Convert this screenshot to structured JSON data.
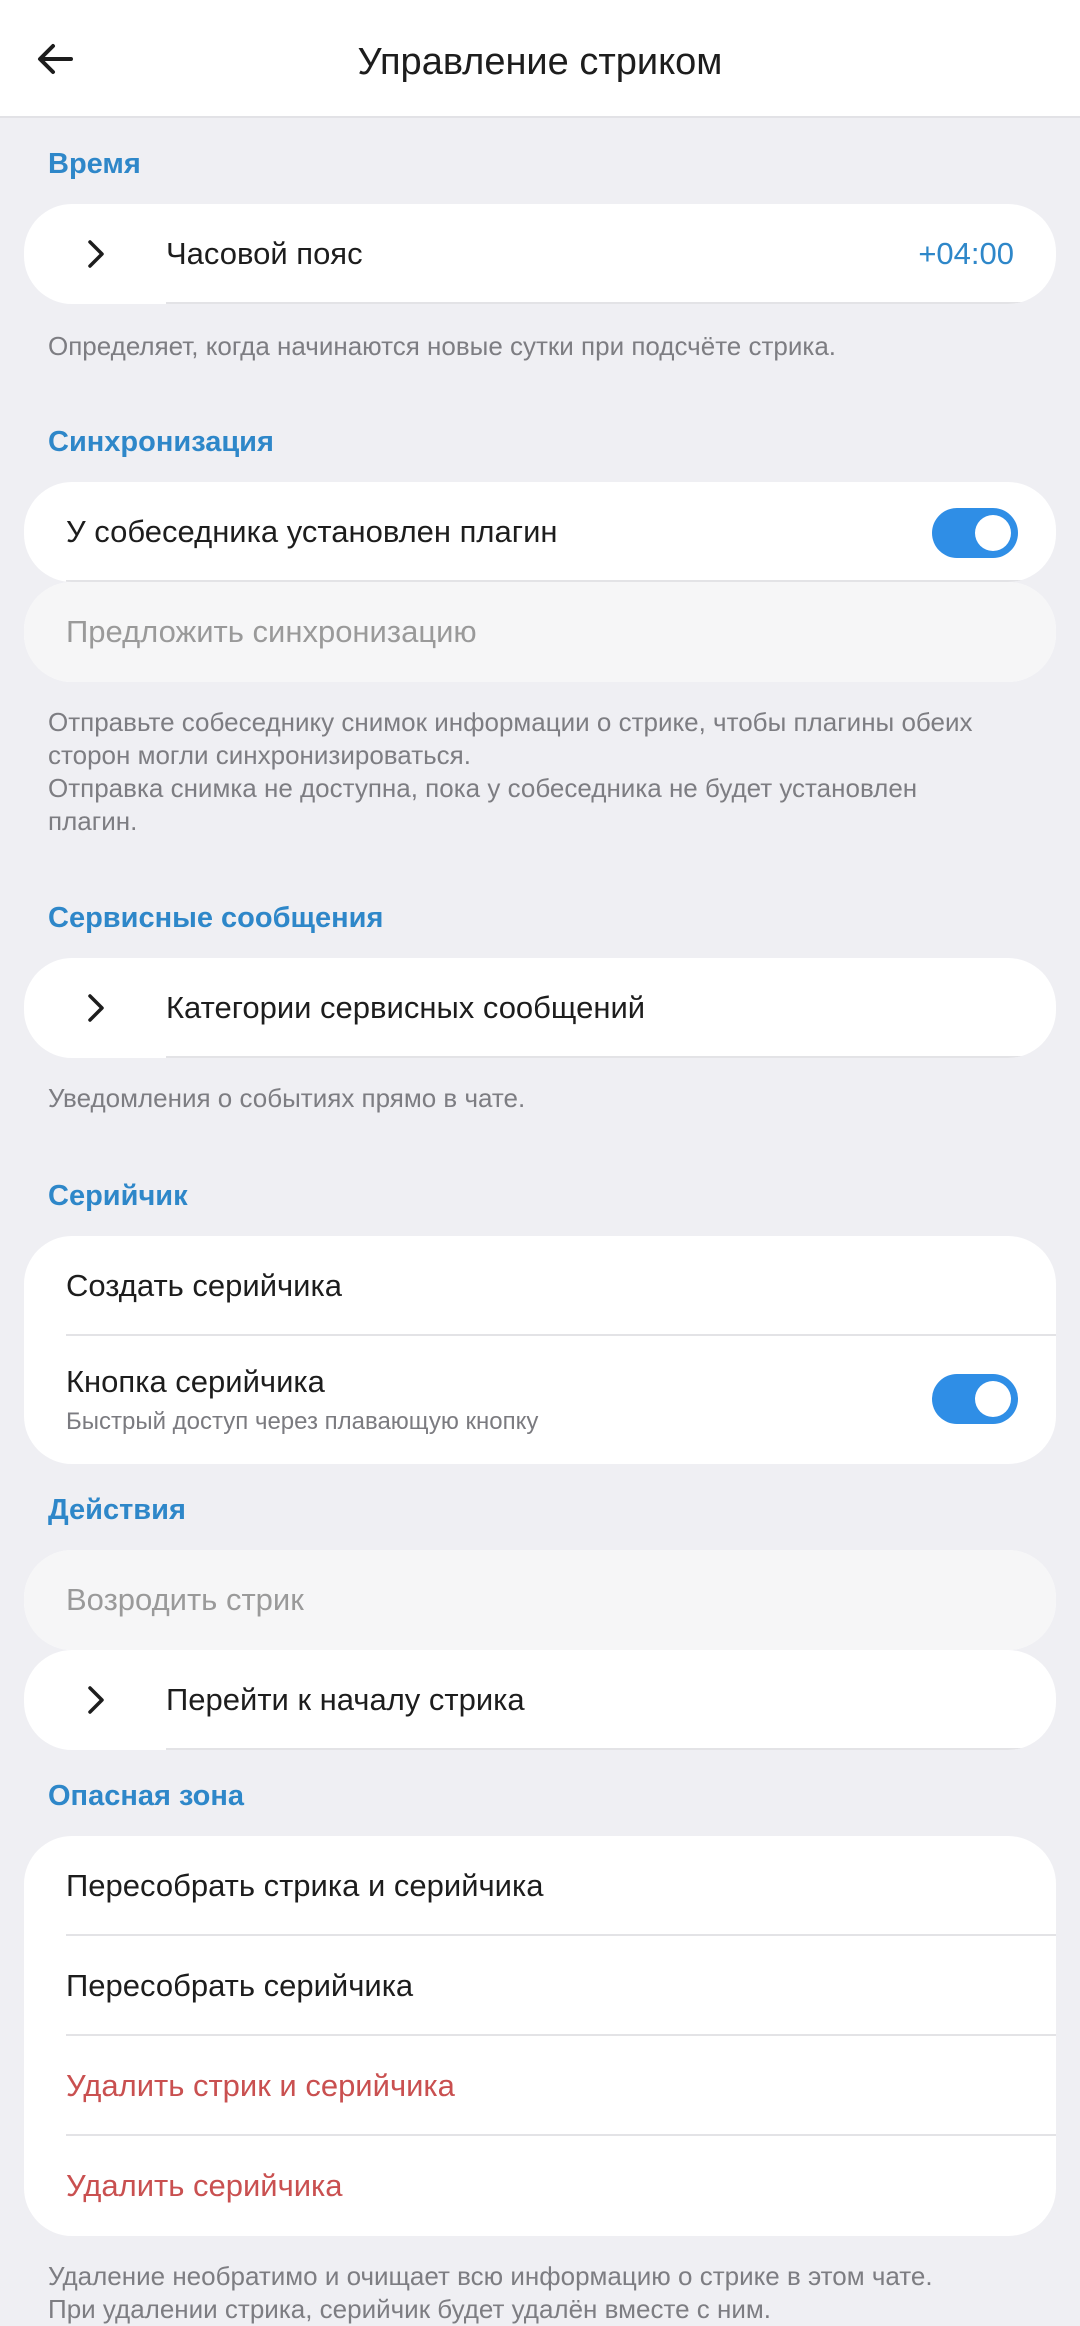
{
  "header": {
    "title": "Управление стриком",
    "back_icon": "arrow-left-icon"
  },
  "time": {
    "header": "Время",
    "timezone_label": "Часовой пояс",
    "timezone_value": "+04:00",
    "note": "Определяет, когда начинаются новые сутки при подсчёте стрика."
  },
  "sync": {
    "header": "Синхронизация",
    "plugin_label": "У собеседника установлен плагин",
    "plugin_enabled": true,
    "offer_label": "Предложить синхронизацию",
    "note_line1": "Отправьте собеседнику снимок информации о стрике, чтобы плагины обеих",
    "note_line2": "сторон могли синхронизироваться.",
    "note_line3": "Отправка снимка не доступна, пока у собеседника не будет установлен",
    "note_line4": "плагин."
  },
  "service": {
    "header": "Сервисные сообщения",
    "categories_label": "Категории сервисных сообщений",
    "note": "Уведомления о событиях прямо в чате."
  },
  "serial": {
    "header": "Серийчик",
    "create_label": "Создать серийчика",
    "button_label": "Кнопка серийчика",
    "button_sub": "Быстрый доступ через плавающую кнопку",
    "button_enabled": true
  },
  "actions": {
    "header": "Действия",
    "revive_label": "Возродить стрик",
    "goto_start_label": "Перейти к началу стрика"
  },
  "danger": {
    "header": "Опасная зона",
    "rebuild_both_label": "Пересобрать стрика и серийчика",
    "rebuild_serial_label": "Пересобрать серийчика",
    "delete_both_label": "Удалить стрик и серийчика",
    "delete_serial_label": "Удалить серийчика",
    "note_line1": "Удаление необратимо и очищает всю информацию о стрике в этом чате.",
    "note_line2": "При удалении стрика, серийчик будет удалён вместе с ним."
  },
  "colors": {
    "accent": "#2e87c9",
    "toggle": "#2f8ee6",
    "danger": "#c95050",
    "background": "#efeff3"
  }
}
